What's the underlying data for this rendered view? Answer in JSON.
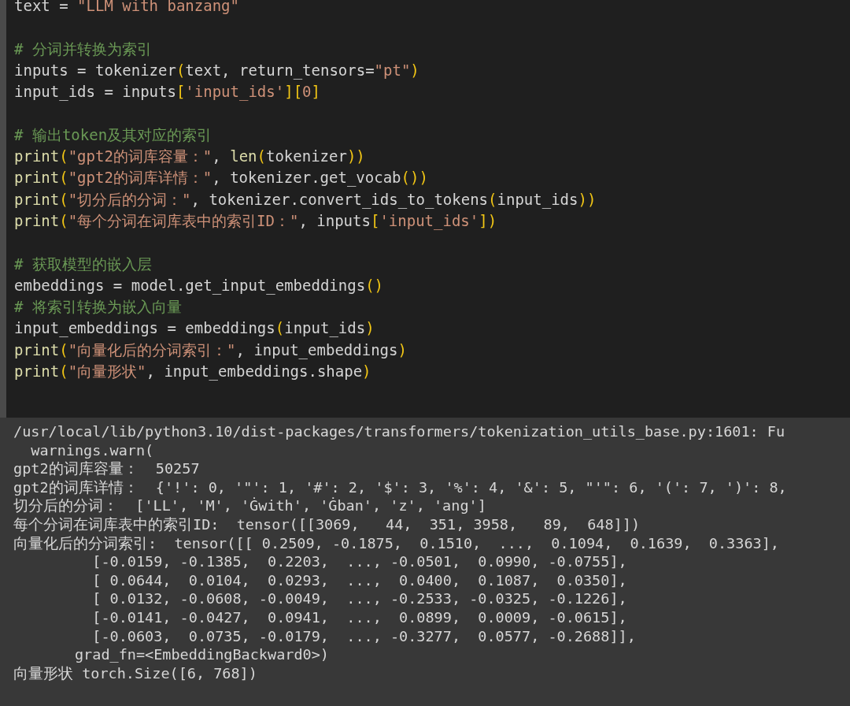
{
  "code_lines": [
    {
      "tokens": [
        {
          "kind": "plain",
          "text": "text = "
        },
        {
          "kind": "str",
          "text": "\"LLM with banzang\""
        }
      ]
    },
    {
      "gap_before": true,
      "tokens": [
        {
          "kind": "comment",
          "text": "# 分词并转换为索引"
        }
      ]
    },
    {
      "tokens": [
        {
          "kind": "plain",
          "text": "inputs = tokenizer"
        },
        {
          "kind": "paren",
          "text": "("
        },
        {
          "kind": "plain",
          "text": "text, return_tensors="
        },
        {
          "kind": "str",
          "text": "\"pt\""
        },
        {
          "kind": "paren",
          "text": ")"
        }
      ]
    },
    {
      "tokens": [
        {
          "kind": "plain",
          "text": "input_ids = inputs"
        },
        {
          "kind": "paren",
          "text": "["
        },
        {
          "kind": "str",
          "text": "'input_ids'"
        },
        {
          "kind": "paren",
          "text": "]["
        },
        {
          "kind": "str",
          "text": "0"
        },
        {
          "kind": "paren",
          "text": "]"
        }
      ]
    },
    {
      "gap_before": true,
      "tokens": [
        {
          "kind": "comment",
          "text": "# 输出token及其对应的索引"
        }
      ]
    },
    {
      "tokens": [
        {
          "kind": "fn",
          "text": "print"
        },
        {
          "kind": "paren",
          "text": "("
        },
        {
          "kind": "str",
          "text": "\"gpt2的词库容量：\""
        },
        {
          "kind": "plain",
          "text": ", "
        },
        {
          "kind": "fn",
          "text": "len"
        },
        {
          "kind": "paren",
          "text": "("
        },
        {
          "kind": "plain",
          "text": "tokenizer"
        },
        {
          "kind": "paren",
          "text": "))"
        }
      ]
    },
    {
      "tokens": [
        {
          "kind": "fn",
          "text": "print"
        },
        {
          "kind": "paren",
          "text": "("
        },
        {
          "kind": "str",
          "text": "\"gpt2的词库详情：\""
        },
        {
          "kind": "plain",
          "text": ", tokenizer.get_vocab"
        },
        {
          "kind": "paren",
          "text": "())"
        }
      ]
    },
    {
      "tokens": [
        {
          "kind": "fn",
          "text": "print"
        },
        {
          "kind": "paren",
          "text": "("
        },
        {
          "kind": "str",
          "text": "\"切分后的分词：\""
        },
        {
          "kind": "plain",
          "text": ", tokenizer.convert_ids_to_tokens"
        },
        {
          "kind": "paren",
          "text": "("
        },
        {
          "kind": "plain",
          "text": "input_ids"
        },
        {
          "kind": "paren",
          "text": "))"
        }
      ]
    },
    {
      "tokens": [
        {
          "kind": "fn",
          "text": "print"
        },
        {
          "kind": "paren",
          "text": "("
        },
        {
          "kind": "str",
          "text": "\"每个分词在词库表中的索引ID：\""
        },
        {
          "kind": "plain",
          "text": ", inputs"
        },
        {
          "kind": "paren",
          "text": "["
        },
        {
          "kind": "str",
          "text": "'input_ids'"
        },
        {
          "kind": "paren",
          "text": "])"
        }
      ]
    },
    {
      "gap_before": true,
      "tokens": [
        {
          "kind": "comment",
          "text": "# 获取模型的嵌入层"
        }
      ]
    },
    {
      "tokens": [
        {
          "kind": "plain",
          "text": "embeddings = model.get_input_embeddings"
        },
        {
          "kind": "paren",
          "text": "()"
        }
      ]
    },
    {
      "tokens": [
        {
          "kind": "comment",
          "text": "# 将索引转换为嵌入向量"
        }
      ]
    },
    {
      "tokens": [
        {
          "kind": "plain",
          "text": "input_embeddings = embeddings"
        },
        {
          "kind": "paren",
          "text": "("
        },
        {
          "kind": "plain",
          "text": "input_ids"
        },
        {
          "kind": "paren",
          "text": ")"
        }
      ]
    },
    {
      "tokens": [
        {
          "kind": "fn",
          "text": "print"
        },
        {
          "kind": "paren",
          "text": "("
        },
        {
          "kind": "str",
          "text": "\"向量化后的分词索引：\""
        },
        {
          "kind": "plain",
          "text": ", input_embeddings"
        },
        {
          "kind": "paren",
          "text": ")"
        }
      ]
    },
    {
      "tokens": [
        {
          "kind": "fn",
          "text": "print"
        },
        {
          "kind": "paren",
          "text": "("
        },
        {
          "kind": "str",
          "text": "\"向量形状\""
        },
        {
          "kind": "plain",
          "text": ", input_embeddings.shape"
        },
        {
          "kind": "paren",
          "text": ")"
        }
      ]
    }
  ],
  "output_lines": [
    "/usr/local/lib/python3.10/dist-packages/transformers/tokenization_utils_base.py:1601: Fu",
    "  warnings.warn(",
    "gpt2的词库容量：  50257",
    "gpt2的词库详情：  {'!': 0, '\"': 1, '#': 2, '$': 3, '%': 4, '&': 5, \"'\": 6, '(': 7, ')': 8,",
    "切分后的分词：  ['LL', 'M', 'Ġwith', 'Ġban', 'z', 'ang']",
    "每个分词在词库表中的索引ID:  tensor([[3069,   44,  351, 3958,   89,  648]])",
    "向量化后的分词索引:  tensor([[ 0.2509, -0.1875,  0.1510,  ...,  0.1094,  0.1639,  0.3363],",
    "         [-0.0159, -0.1385,  0.2203,  ..., -0.0501,  0.0990, -0.0755],",
    "         [ 0.0644,  0.0104,  0.0293,  ...,  0.0400,  0.1087,  0.0350],",
    "         [ 0.0132, -0.0608, -0.0049,  ..., -0.2533, -0.0325, -0.1226],",
    "         [-0.0141, -0.0427,  0.0941,  ...,  0.0899,  0.0009, -0.0615],",
    "         [-0.0603,  0.0735, -0.0179,  ..., -0.3277,  0.0577, -0.2688]],",
    "       grad_fn=<EmbeddingBackward0>)",
    "向量形状 torch.Size([6, 768])"
  ]
}
